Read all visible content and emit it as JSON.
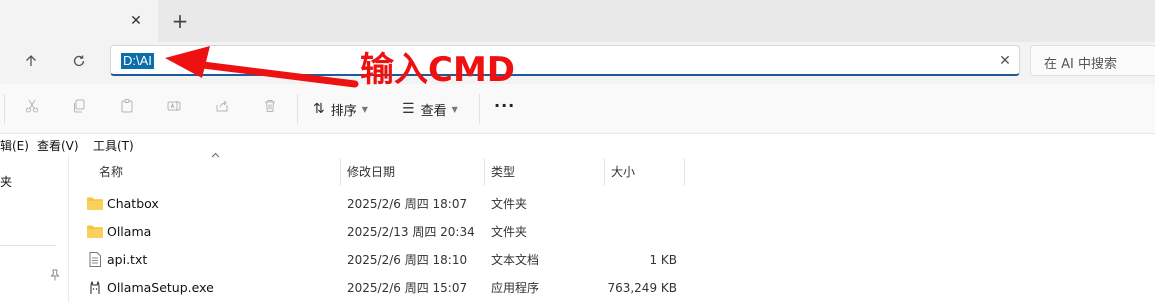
{
  "tabstrip": {
    "close_glyph": "✕",
    "new_tab_glyph": "+"
  },
  "nav": {
    "up_icon": "arrow-up-icon",
    "refresh_icon": "refresh-icon"
  },
  "address": {
    "value": "D:\\AI",
    "clear_glyph": "✕"
  },
  "search": {
    "placeholder": "在 AI 中搜索"
  },
  "annotation": {
    "text": "输入CMD",
    "color": "#ee1111"
  },
  "toolbar": {
    "sort_label": "排序",
    "view_label": "查看",
    "more_glyph": "···"
  },
  "menubar": {
    "items": [
      "编辑(E)",
      "查看(V)",
      "工具(T)"
    ]
  },
  "sidebar": {
    "label": "夹"
  },
  "columns": {
    "name": "名称",
    "modified": "修改日期",
    "type": "类型",
    "size": "大小"
  },
  "files": [
    {
      "name": "Chatbox",
      "modified": "2025/2/6 周四 18:07",
      "type": "文件夹",
      "size": "",
      "icon": "folder-icon"
    },
    {
      "name": "Ollama",
      "modified": "2025/2/13 周四 20:34",
      "type": "文件夹",
      "size": "",
      "icon": "folder-icon"
    },
    {
      "name": "api.txt",
      "modified": "2025/2/6 周四 18:10",
      "type": "文本文档",
      "size": "1 KB",
      "icon": "text-file-icon"
    },
    {
      "name": "OllamaSetup.exe",
      "modified": "2025/2/6 周四 15:07",
      "type": "应用程序",
      "size": "763,249 KB",
      "icon": "ollama-app-icon"
    }
  ],
  "colors": {
    "accent": "#1f5b98",
    "selection": "#0a6eaa",
    "folder": "#f6c343"
  }
}
